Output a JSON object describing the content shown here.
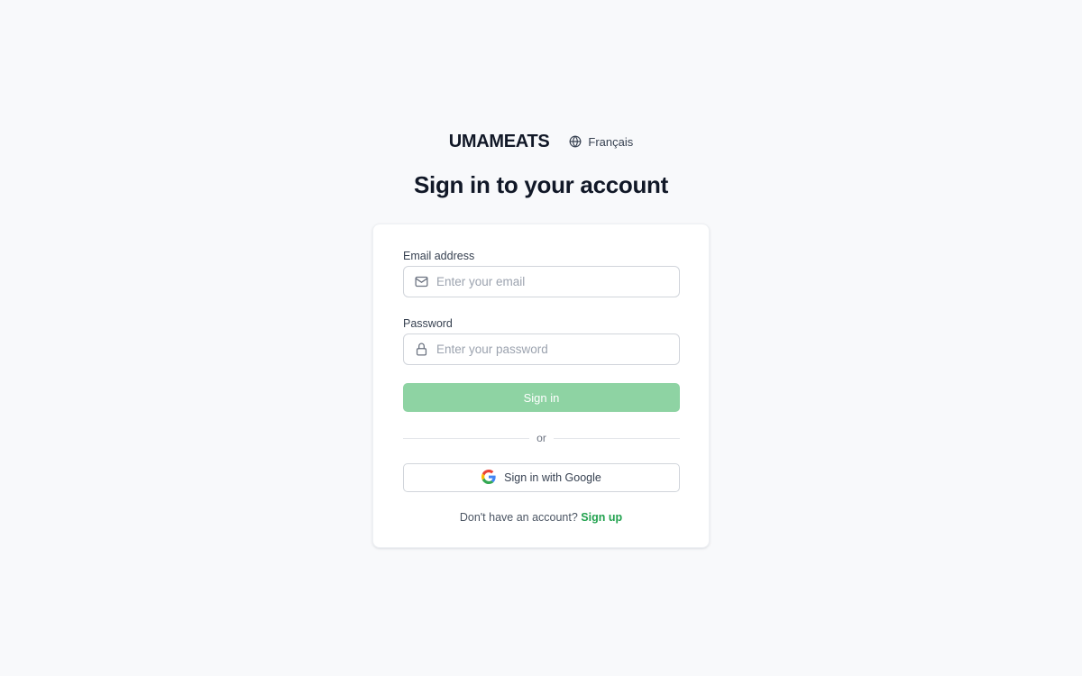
{
  "brand": {
    "name": "UMAMEATS"
  },
  "language": {
    "label": "Français",
    "icon": "globe-icon"
  },
  "heading": "Sign in to your account",
  "form": {
    "email": {
      "label": "Email address",
      "placeholder": "Enter your email",
      "value": "",
      "icon": "mail-icon"
    },
    "password": {
      "label": "Password",
      "placeholder": "Enter your password",
      "value": "",
      "icon": "lock-icon"
    },
    "submit_label": "Sign in",
    "divider_text": "or",
    "google_label": "Sign in with Google",
    "footer_prompt": "Don't have an account?",
    "signup_link": "Sign up"
  },
  "colors": {
    "accent": "#22a24f",
    "button_disabled": "#8ed3a3",
    "background": "#f8f9fb"
  }
}
